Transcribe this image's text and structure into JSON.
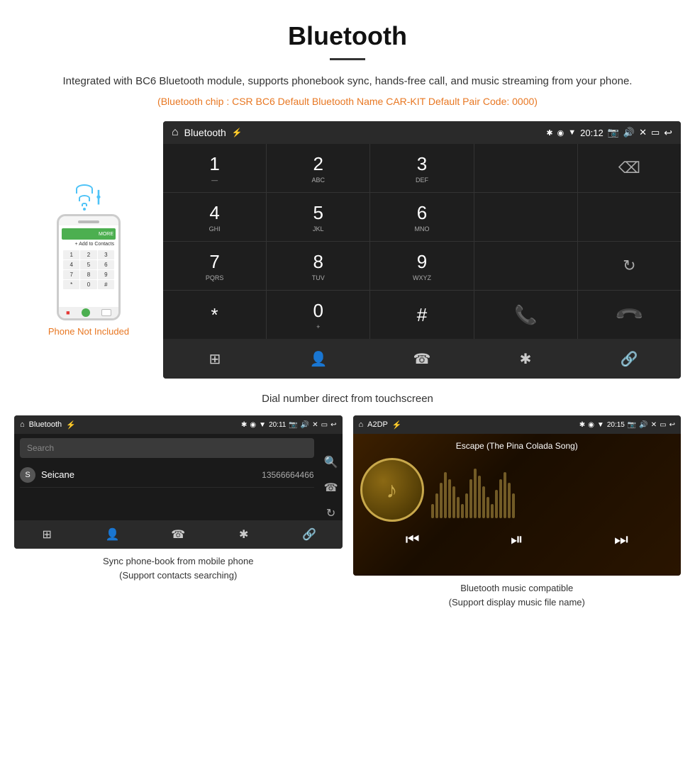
{
  "header": {
    "title": "Bluetooth",
    "description": "Integrated with BC6 Bluetooth module, supports phonebook sync, hands-free call, and music streaming from your phone.",
    "specs": "(Bluetooth chip : CSR BC6    Default Bluetooth Name CAR-KIT    Default Pair Code: 0000)"
  },
  "phone_label": "Phone Not Included",
  "dial_screen": {
    "status_bar": {
      "title": "Bluetooth",
      "time": "20:12"
    },
    "keys": [
      {
        "main": "1",
        "sub": ""
      },
      {
        "main": "2",
        "sub": "ABC"
      },
      {
        "main": "3",
        "sub": "DEF"
      },
      {
        "main": "",
        "sub": ""
      },
      {
        "main": "⌫",
        "sub": ""
      }
    ],
    "keys_row2": [
      {
        "main": "4",
        "sub": "GHI"
      },
      {
        "main": "5",
        "sub": "JKL"
      },
      {
        "main": "6",
        "sub": "MNO"
      },
      {
        "main": "",
        "sub": ""
      },
      {
        "main": "",
        "sub": ""
      }
    ],
    "keys_row3": [
      {
        "main": "7",
        "sub": "PQRS"
      },
      {
        "main": "8",
        "sub": "TUV"
      },
      {
        "main": "9",
        "sub": "WXYZ"
      },
      {
        "main": "",
        "sub": ""
      },
      {
        "main": "↺",
        "sub": ""
      }
    ],
    "keys_row4": [
      {
        "main": "*",
        "sub": ""
      },
      {
        "main": "0",
        "sub": "+"
      },
      {
        "main": "#",
        "sub": ""
      },
      {
        "main": "📞",
        "sub": "green"
      },
      {
        "main": "📞",
        "sub": "red"
      }
    ]
  },
  "dial_caption": "Dial number direct from touchscreen",
  "phonebook_screen": {
    "title": "Bluetooth",
    "time": "20:11",
    "search_placeholder": "Search",
    "contact": {
      "initial": "S",
      "name": "Seicane",
      "number": "13566664466"
    }
  },
  "phonebook_caption": "Sync phone-book from mobile phone\n(Support contacts searching)",
  "music_screen": {
    "title": "A2DP",
    "time": "20:15",
    "song_title": "Escape (The Pina Colada Song)",
    "viz_heights": [
      20,
      35,
      50,
      65,
      55,
      45,
      30,
      20,
      35,
      55,
      70,
      60,
      45,
      30,
      20,
      40,
      55,
      65,
      50,
      35
    ]
  },
  "music_caption": "Bluetooth music compatible\n(Support display music file name)"
}
